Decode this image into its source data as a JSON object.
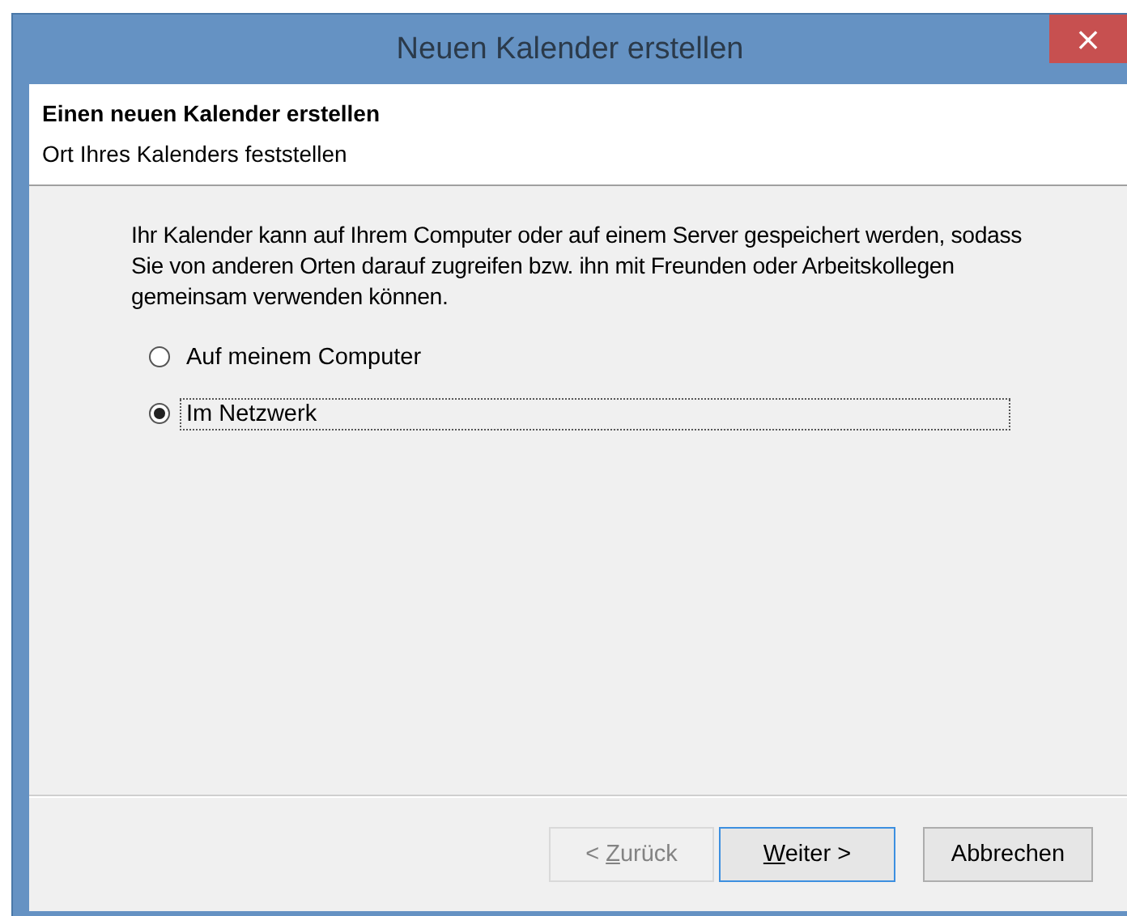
{
  "window": {
    "title": "Neuen Kalender erstellen",
    "close": "×"
  },
  "header": {
    "title": "Einen neuen Kalender erstellen",
    "subtitle": "Ort Ihres Kalenders feststellen"
  },
  "description": "Ihr Kalender kann auf Ihrem Computer oder auf einem Server gespeichert werden, sodass Sie von anderen Orten darauf zugreifen bzw. ihn mit Freunden oder Arbeitskollegen gemeinsam verwenden können.",
  "options": [
    {
      "label": "Auf meinem Computer",
      "selected": false
    },
    {
      "label": "Im Netzwerk",
      "selected": true
    }
  ],
  "buttons": [
    {
      "prefix": "< ",
      "access_key": "Z",
      "rest": "urück",
      "disabled": true,
      "default": false
    },
    {
      "access_key": "W",
      "rest": "eiter >",
      "disabled": false,
      "default": true
    },
    {
      "rest": "Abbrechen",
      "disabled": false,
      "default": false
    }
  ]
}
